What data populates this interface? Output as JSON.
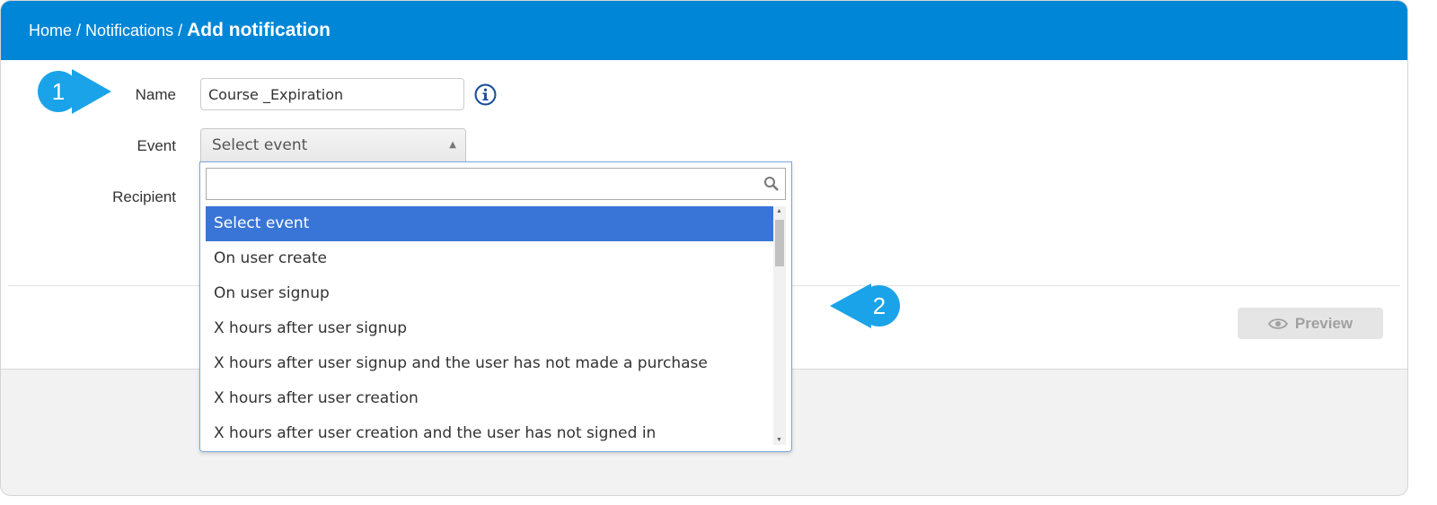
{
  "breadcrumb": {
    "home": "Home",
    "notifications": "Notifications",
    "current": "Add notification",
    "separator": "/"
  },
  "form": {
    "name_label": "Name",
    "name_value": "Course _Expiration",
    "event_label": "Event",
    "event_selected": "Select event",
    "recipient_label": "Recipient"
  },
  "dropdown": {
    "search_value": "",
    "options": [
      "Select event",
      "On user create",
      "On user signup",
      "X hours after user signup",
      "X hours after user signup and the user has not made a purchase",
      "X hours after user creation",
      "X hours after user creation and the user has not signed in"
    ],
    "selected_index": 0
  },
  "actions": {
    "preview_label": "Preview"
  },
  "callouts": {
    "one": "1",
    "two": "2"
  },
  "colors": {
    "header": "#0086d6",
    "selected_option": "#3875d7",
    "callout": "#1aa3e8"
  }
}
